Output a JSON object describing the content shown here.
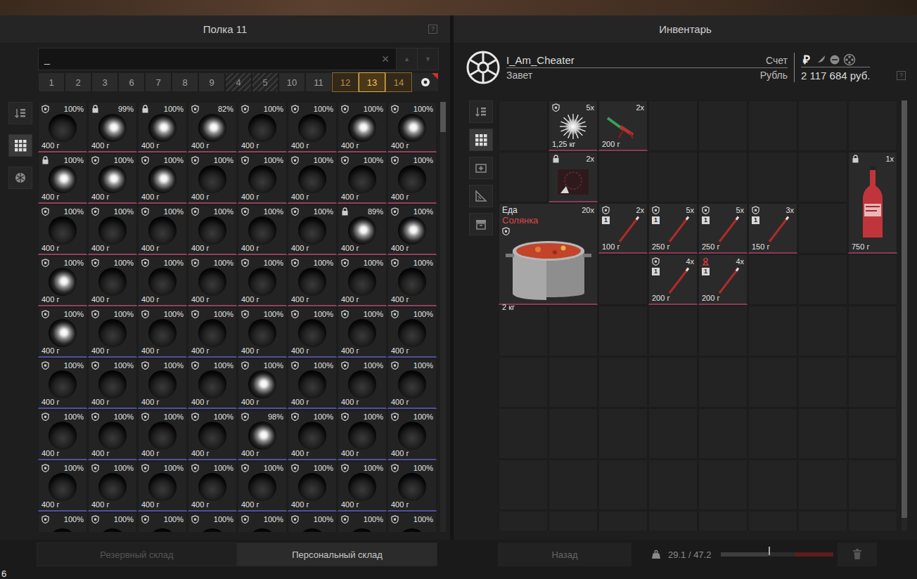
{
  "shelf": {
    "title": "Полка 11",
    "help": "?",
    "search": {
      "value": "_",
      "clear": "×",
      "up": "▲",
      "down": "▼"
    },
    "tabs": [
      {
        "label": "1",
        "kind": "plain",
        "selected": false
      },
      {
        "label": "2",
        "kind": "plain",
        "selected": false
      },
      {
        "label": "3",
        "kind": "plain",
        "selected": false
      },
      {
        "label": "6",
        "kind": "plain",
        "selected": false
      },
      {
        "label": "7",
        "kind": "plain",
        "selected": false
      },
      {
        "label": "8",
        "kind": "plain",
        "selected": false
      },
      {
        "label": "9",
        "kind": "plain",
        "selected": false
      },
      {
        "label": "4",
        "kind": "hatched",
        "selected": false
      },
      {
        "label": "5",
        "kind": "hatched",
        "selected": false
      },
      {
        "label": "10",
        "kind": "plain",
        "selected": false
      },
      {
        "label": "11",
        "kind": "plain",
        "selected": false
      },
      {
        "label": "12",
        "kind": "gold",
        "selected": false
      },
      {
        "label": "13",
        "kind": "gold",
        "selected": true
      },
      {
        "label": "14",
        "kind": "gold",
        "selected": false
      },
      {
        "kind": "special",
        "selected": false
      }
    ],
    "tools": [
      {
        "kind": "sort",
        "selected": false
      },
      {
        "kind": "grid",
        "selected": true
      },
      {
        "kind": "artefact",
        "selected": false
      }
    ],
    "scrollbar": {
      "level": 0.07
    },
    "items": [
      {
        "locked": false,
        "percent": "100%",
        "weight": "400 г",
        "bright": false,
        "color": "#93405e"
      },
      {
        "locked": true,
        "percent": "99%",
        "weight": "400 г",
        "bright": true,
        "color": "#93405e"
      },
      {
        "locked": true,
        "percent": "100%",
        "weight": "400 г",
        "bright": true,
        "color": "#93405e"
      },
      {
        "locked": false,
        "percent": "82%",
        "weight": "400 г",
        "bright": true,
        "color": "#93405e"
      },
      {
        "locked": false,
        "percent": "100%",
        "weight": "400 г",
        "bright": false,
        "color": "#93405e"
      },
      {
        "locked": false,
        "percent": "100%",
        "weight": "400 г",
        "bright": false,
        "color": "#93405e"
      },
      {
        "locked": false,
        "percent": "100%",
        "weight": "400 г",
        "bright": true,
        "color": "#93405e"
      },
      {
        "locked": false,
        "percent": "100%",
        "weight": "400 г",
        "bright": true,
        "color": "#93405e"
      },
      {
        "locked": true,
        "percent": "100%",
        "weight": "400 г",
        "bright": true,
        "color": "#93405e"
      },
      {
        "locked": false,
        "percent": "100%",
        "weight": "400 г",
        "bright": true,
        "color": "#93405e"
      },
      {
        "locked": false,
        "percent": "100%",
        "weight": "400 г",
        "bright": true,
        "color": "#93405e"
      },
      {
        "locked": false,
        "percent": "100%",
        "weight": "400 г",
        "bright": false,
        "color": "#93405e"
      },
      {
        "locked": false,
        "percent": "100%",
        "weight": "400 г",
        "bright": false,
        "color": "#93405e"
      },
      {
        "locked": false,
        "percent": "100%",
        "weight": "400 г",
        "bright": false,
        "color": "#93405e"
      },
      {
        "locked": false,
        "percent": "100%",
        "weight": "400 г",
        "bright": false,
        "color": "#93405e"
      },
      {
        "locked": false,
        "percent": "100%",
        "weight": "400 г",
        "bright": false,
        "color": "#93405e"
      },
      {
        "locked": false,
        "percent": "100%",
        "weight": "400 г",
        "bright": false,
        "color": "#93405e"
      },
      {
        "locked": false,
        "percent": "100%",
        "weight": "400 г",
        "bright": false,
        "color": "#93405e"
      },
      {
        "locked": false,
        "percent": "100%",
        "weight": "400 г",
        "bright": false,
        "color": "#93405e"
      },
      {
        "locked": false,
        "percent": "100%",
        "weight": "400 г",
        "bright": false,
        "color": "#93405e"
      },
      {
        "locked": false,
        "percent": "100%",
        "weight": "400 г",
        "bright": false,
        "color": "#93405e"
      },
      {
        "locked": false,
        "percent": "100%",
        "weight": "400 г",
        "bright": false,
        "color": "#93405e"
      },
      {
        "locked": true,
        "percent": "89%",
        "weight": "400 г",
        "bright": true,
        "color": "#93405e"
      },
      {
        "locked": false,
        "percent": "100%",
        "weight": "400 г",
        "bright": true,
        "color": "#93405e"
      },
      {
        "locked": false,
        "percent": "100%",
        "weight": "400 г",
        "bright": true,
        "color": "#93405e"
      },
      {
        "locked": false,
        "percent": "100%",
        "weight": "400 г",
        "bright": false,
        "color": "#93405e"
      },
      {
        "locked": false,
        "percent": "100%",
        "weight": "400 г",
        "bright": false,
        "color": "#93405e"
      },
      {
        "locked": false,
        "percent": "100%",
        "weight": "400 г",
        "bright": false,
        "color": "#93405e"
      },
      {
        "locked": false,
        "percent": "100%",
        "weight": "400 г",
        "bright": false,
        "color": "#93405e"
      },
      {
        "locked": false,
        "percent": "100%",
        "weight": "400 г",
        "bright": false,
        "color": "#93405e"
      },
      {
        "locked": false,
        "percent": "100%",
        "weight": "400 г",
        "bright": false,
        "color": "#93405e"
      },
      {
        "locked": false,
        "percent": "100%",
        "weight": "400 г",
        "bright": false,
        "color": "#93405e"
      },
      {
        "locked": false,
        "percent": "100%",
        "weight": "400 г",
        "bright": true,
        "color": "#5050a0"
      },
      {
        "locked": false,
        "percent": "100%",
        "weight": "400 г",
        "bright": false,
        "color": "#5050a0"
      },
      {
        "locked": false,
        "percent": "100%",
        "weight": "400 г",
        "bright": false,
        "color": "#5050a0"
      },
      {
        "locked": false,
        "percent": "100%",
        "weight": "400 г",
        "bright": false,
        "color": "#5050a0"
      },
      {
        "locked": false,
        "percent": "100%",
        "weight": "400 г",
        "bright": false,
        "color": "#5050a0"
      },
      {
        "locked": false,
        "percent": "100%",
        "weight": "400 г",
        "bright": false,
        "color": "#5050a0"
      },
      {
        "locked": false,
        "percent": "100%",
        "weight": "400 г",
        "bright": false,
        "color": "#5050a0"
      },
      {
        "locked": false,
        "percent": "100%",
        "weight": "400 г",
        "bright": false,
        "color": "#5050a0"
      },
      {
        "locked": false,
        "percent": "100%",
        "weight": "400 г",
        "bright": false,
        "color": "#5050a0"
      },
      {
        "locked": false,
        "percent": "100%",
        "weight": "400 г",
        "bright": false,
        "color": "#5050a0"
      },
      {
        "locked": false,
        "percent": "100%",
        "weight": "400 г",
        "bright": false,
        "color": "#5050a0"
      },
      {
        "locked": false,
        "percent": "100%",
        "weight": "400 г",
        "bright": false,
        "color": "#5050a0"
      },
      {
        "locked": false,
        "percent": "100%",
        "weight": "400 г",
        "bright": true,
        "color": "#5050a0"
      },
      {
        "locked": false,
        "percent": "100%",
        "weight": "400 г",
        "bright": false,
        "color": "#5050a0"
      },
      {
        "locked": false,
        "percent": "100%",
        "weight": "400 г",
        "bright": false,
        "color": "#5050a0"
      },
      {
        "locked": false,
        "percent": "100%",
        "weight": "400 г",
        "bright": false,
        "color": "#5050a0"
      },
      {
        "locked": false,
        "percent": "100%",
        "weight": "400 г",
        "bright": false,
        "color": "#5050a0"
      },
      {
        "locked": false,
        "percent": "100%",
        "weight": "400 г",
        "bright": false,
        "color": "#5050a0"
      },
      {
        "locked": false,
        "percent": "100%",
        "weight": "400 г",
        "bright": false,
        "color": "#5050a0"
      },
      {
        "locked": false,
        "percent": "100%",
        "weight": "400 г",
        "bright": false,
        "color": "#5050a0"
      },
      {
        "locked": false,
        "percent": "98%",
        "weight": "400 г",
        "bright": true,
        "color": "#5050a0"
      },
      {
        "locked": false,
        "percent": "100%",
        "weight": "400 г",
        "bright": false,
        "color": "#5050a0"
      },
      {
        "locked": false,
        "percent": "100%",
        "weight": "400 г",
        "bright": false,
        "color": "#5050a0"
      },
      {
        "locked": false,
        "percent": "100%",
        "weight": "400 г",
        "bright": false,
        "color": "#5050a0"
      },
      {
        "locked": false,
        "percent": "100%",
        "weight": "400 г",
        "bright": false,
        "color": "#5050a0"
      },
      {
        "locked": false,
        "percent": "100%",
        "weight": "400 г",
        "bright": false,
        "color": "#5050a0"
      },
      {
        "locked": false,
        "percent": "100%",
        "weight": "400 г",
        "bright": false,
        "color": "#5050a0"
      },
      {
        "locked": false,
        "percent": "100%",
        "weight": "400 г",
        "bright": false,
        "color": "#5050a0"
      },
      {
        "locked": false,
        "percent": "100%",
        "weight": "400 г",
        "bright": false,
        "color": "#5050a0"
      },
      {
        "locked": false,
        "percent": "100%",
        "weight": "400 г",
        "bright": false,
        "color": "#5050a0"
      },
      {
        "locked": false,
        "percent": "100%",
        "weight": "400 г",
        "bright": false,
        "color": "#5050a0"
      },
      {
        "locked": false,
        "percent": "100%",
        "weight": "400 г",
        "bright": false,
        "color": "#5050a0"
      },
      {
        "locked": false,
        "percent": "100%",
        "bright": false,
        "color": "#5050a0"
      },
      {
        "locked": false,
        "percent": "100%",
        "bright": false,
        "color": "#5050a0"
      },
      {
        "locked": false,
        "percent": "100%",
        "bright": false,
        "color": "#5050a0"
      },
      {
        "locked": false,
        "percent": "100%",
        "bright": false,
        "color": "#5050a0"
      },
      {
        "locked": false,
        "percent": "100%",
        "bright": false,
        "color": "#5050a0"
      },
      {
        "locked": false,
        "percent": "100%",
        "bright": false,
        "color": "#5050a0"
      },
      {
        "locked": false,
        "percent": "100%",
        "bright": false,
        "color": "#5050a0"
      },
      {
        "locked": false,
        "percent": "100%",
        "bright": false,
        "color": "#5050a0"
      }
    ]
  },
  "inventory": {
    "title": "Инвентарь",
    "player": {
      "name": "I_Am_Cheater",
      "faction": "Завет",
      "account_label": "Счет",
      "currency_label": "Рубль",
      "balance": "2 117 684 руб.",
      "help": "?"
    },
    "currencies": [
      {
        "kind": "rub",
        "symbol": "₽",
        "selected": true
      },
      {
        "kind": "feather",
        "selected": false
      },
      {
        "kind": "coin",
        "selected": false
      },
      {
        "kind": "reel",
        "selected": false
      }
    ],
    "tools": [
      {
        "kind": "sort",
        "selected": false
      },
      {
        "kind": "grid",
        "selected": true
      },
      {
        "kind": "medkit",
        "selected": false
      },
      {
        "kind": "ruler",
        "selected": false
      },
      {
        "kind": "box",
        "selected": false
      }
    ],
    "scrollbar": {
      "level": 0.97
    },
    "items": [
      {
        "cell": [
          1,
          0
        ],
        "span": [
          1,
          1
        ],
        "kind": "burst",
        "mark": "shield",
        "count": "5x",
        "weight": "1,25 кг"
      },
      {
        "cell": [
          2,
          0
        ],
        "span": [
          1,
          1
        ],
        "kind": "drill",
        "mark": "none",
        "count": "2x",
        "weight": "200 г"
      },
      {
        "cell": [
          1,
          1
        ],
        "span": [
          1,
          1
        ],
        "kind": "dark",
        "mark": "lock",
        "count": "2x"
      },
      {
        "cell": [
          7,
          1
        ],
        "span": [
          1,
          2
        ],
        "kind": "bottle",
        "mark": "lock",
        "count": "1x",
        "weight": "750 г"
      },
      {
        "cell": [
          0,
          2
        ],
        "span": [
          2,
          2
        ],
        "kind": "pot",
        "mark": "shield",
        "category": "Еда",
        "name": "Солянка",
        "count": "20x",
        "weight": "2 кг"
      },
      {
        "cell": [
          2,
          2
        ],
        "span": [
          1,
          1
        ],
        "kind": "stick",
        "mark": "shield",
        "tier": "1",
        "count": "2x",
        "weight": "100 г"
      },
      {
        "cell": [
          3,
          2
        ],
        "span": [
          1,
          1
        ],
        "kind": "stick",
        "mark": "shield",
        "tier": "1",
        "count": "5x",
        "weight": "250 г"
      },
      {
        "cell": [
          4,
          2
        ],
        "span": [
          1,
          1
        ],
        "kind": "stick",
        "mark": "shield",
        "tier": "1",
        "count": "5x",
        "weight": "250 г"
      },
      {
        "cell": [
          5,
          2
        ],
        "span": [
          1,
          1
        ],
        "kind": "stick",
        "mark": "shield",
        "tier": "1",
        "count": "3x",
        "weight": "150 г"
      },
      {
        "cell": [
          3,
          3
        ],
        "span": [
          1,
          1
        ],
        "kind": "stick",
        "mark": "shield",
        "tier": "1",
        "count": "4x",
        "weight": "200 г"
      },
      {
        "cell": [
          4,
          3
        ],
        "span": [
          1,
          1
        ],
        "kind": "stick",
        "mark": "warn",
        "tier": "1",
        "count": "4x",
        "weight": "200 г"
      }
    ]
  },
  "storage_tabs": [
    {
      "label": "Резервный склад",
      "selected": false
    },
    {
      "label": "Персональный склад",
      "selected": true
    }
  ],
  "back_button": "Назад",
  "weight": {
    "reading": "29.1 / 47.2",
    "level": 0.42
  },
  "corner_label": "6"
}
